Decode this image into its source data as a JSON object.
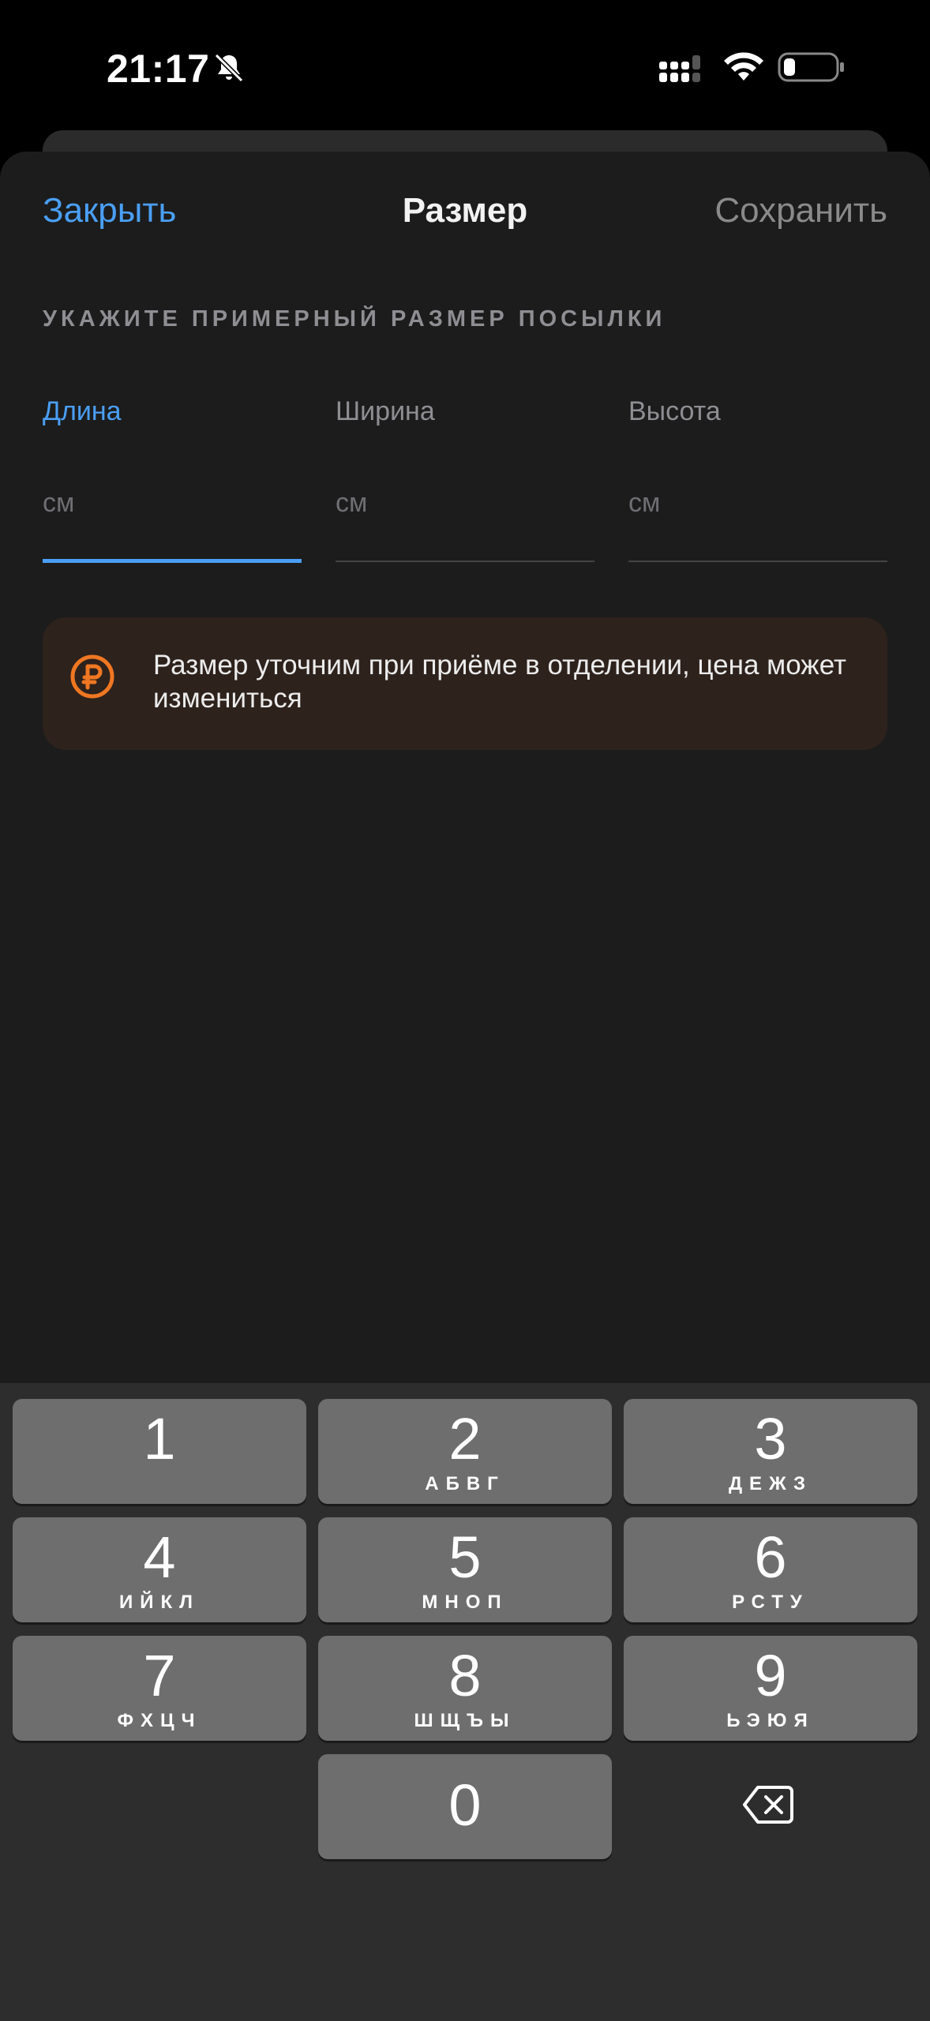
{
  "status_bar": {
    "time": "21:17",
    "icons": [
      "bell-slash-icon",
      "signal-icon",
      "wifi-icon",
      "battery-icon"
    ]
  },
  "nav": {
    "close_label": "Закрыть",
    "title": "Размер",
    "save_label": "Сохранить"
  },
  "section_header": "УКАЖИТЕ ПРИМЕРНЫЙ РАЗМЕР ПОСЫЛКИ",
  "fields": [
    {
      "label": "Длина",
      "placeholder": "см",
      "value": "",
      "active": true
    },
    {
      "label": "Ширина",
      "placeholder": "см",
      "value": "",
      "active": false
    },
    {
      "label": "Высота",
      "placeholder": "см",
      "value": "",
      "active": false
    }
  ],
  "notice": {
    "icon": "ruble-icon",
    "text": "Размер уточним при приёме в отделении, цена может измениться"
  },
  "keyboard": {
    "keys": [
      {
        "digit": "1",
        "letters": ""
      },
      {
        "digit": "2",
        "letters": "АБВГ"
      },
      {
        "digit": "3",
        "letters": "ДЕЖЗ"
      },
      {
        "digit": "4",
        "letters": "ИЙКЛ"
      },
      {
        "digit": "5",
        "letters": "МНОП"
      },
      {
        "digit": "6",
        "letters": "РСТУ"
      },
      {
        "digit": "7",
        "letters": "ФХЦЧ"
      },
      {
        "digit": "8",
        "letters": "ШЩЪЫ"
      },
      {
        "digit": "9",
        "letters": "ЬЭЮЯ"
      },
      {
        "digit": "0",
        "letters": ""
      }
    ],
    "backspace_icon": "backspace-icon"
  },
  "colors": {
    "accent": "#4a9ff5",
    "notice_icon": "#f07722",
    "notice_bg": "#2e221c",
    "sheet_bg": "#1c1c1c"
  }
}
